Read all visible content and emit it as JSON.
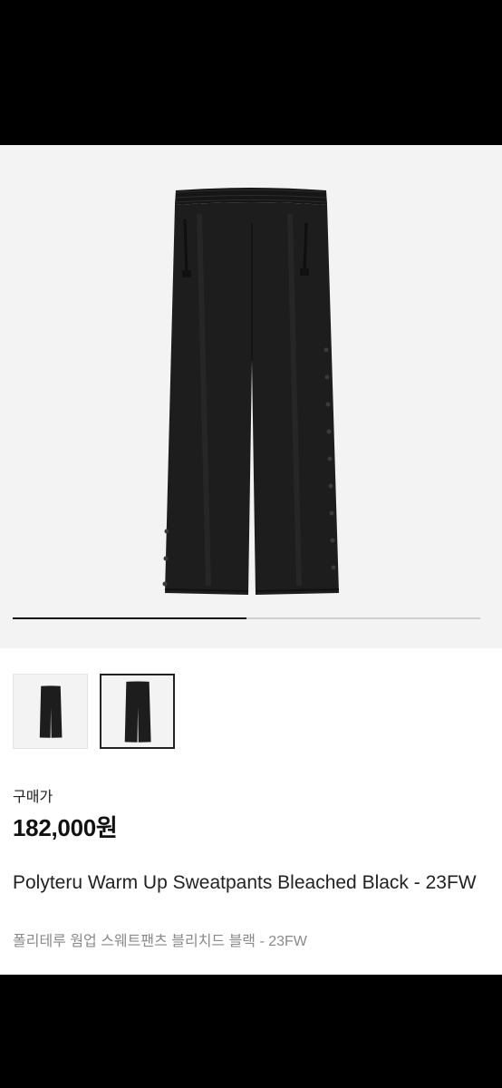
{
  "gallery": {
    "current_index": 2,
    "total_images": 2,
    "progress_fraction": 0.5,
    "thumbnails": [
      {
        "alt": "pants-front-view",
        "selected": false
      },
      {
        "alt": "pants-side-view",
        "selected": true
      }
    ]
  },
  "product": {
    "price_label": "구매가",
    "price": "182,000원",
    "name_en": "Polyteru Warm Up Sweatpants Bleached Black - 23FW",
    "name_ko": "폴리테루 웜업 스웨트팬츠 블리치드 블랙 - 23FW"
  },
  "colors": {
    "garment": "#1b1b1b",
    "hero_bg": "#f3f3f3",
    "progress_active": "#111111",
    "progress_track": "#cfcfcf"
  }
}
